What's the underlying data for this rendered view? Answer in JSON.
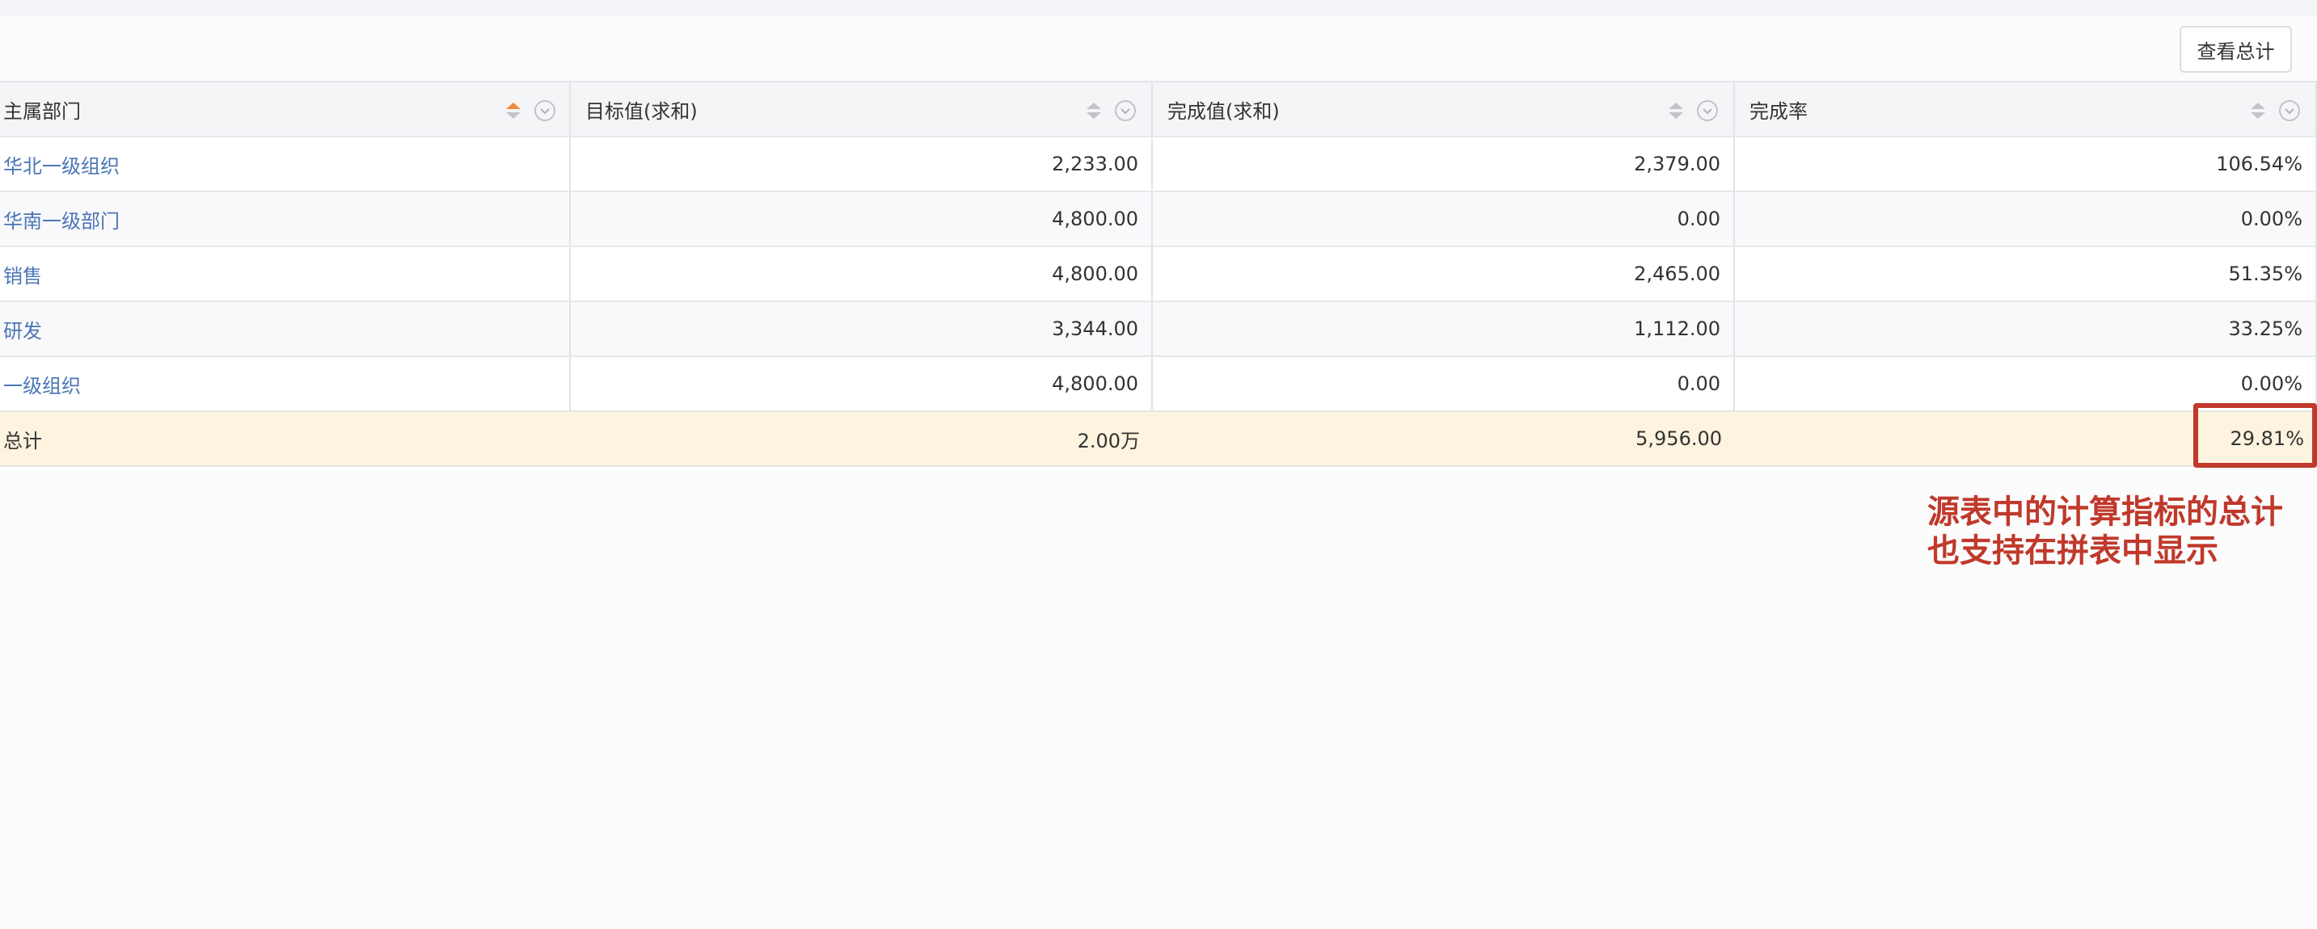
{
  "toolbar": {
    "view_total_label": "查看总计"
  },
  "table": {
    "columns": [
      {
        "label": "主属部门",
        "sort": "ascending"
      },
      {
        "label": "目标值(求和)",
        "sort": "none"
      },
      {
        "label": "完成值(求和)",
        "sort": "none"
      },
      {
        "label": "完成率",
        "sort": "none"
      }
    ],
    "rows": [
      {
        "dept": "华北一级组织",
        "target": "2,233.00",
        "done": "2,379.00",
        "rate": "106.54%"
      },
      {
        "dept": "华南一级部门",
        "target": "4,800.00",
        "done": "0.00",
        "rate": "0.00%"
      },
      {
        "dept": "销售",
        "target": "4,800.00",
        "done": "2,465.00",
        "rate": "51.35%"
      },
      {
        "dept": "研发",
        "target": "3,344.00",
        "done": "1,112.00",
        "rate": "33.25%"
      },
      {
        "dept": "一级组织",
        "target": "4,800.00",
        "done": "0.00",
        "rate": "0.00%"
      }
    ],
    "total": {
      "label": "总计",
      "target": "2.00万",
      "done": "5,956.00",
      "rate": "29.81%"
    }
  },
  "annotation": {
    "line1": "源表中的计算指标的总计",
    "line2": "也支持在拼表中显示"
  },
  "colors": {
    "link": "#4a75b5",
    "total_row_bg": "#fdf3de",
    "annotation": "#c0392b",
    "sort_active": "#e98a3e",
    "sort_inactive": "#c2c4c8"
  },
  "icons": {
    "sort": "sort-arrows-icon",
    "menu": "chevron-down-circle-icon"
  }
}
